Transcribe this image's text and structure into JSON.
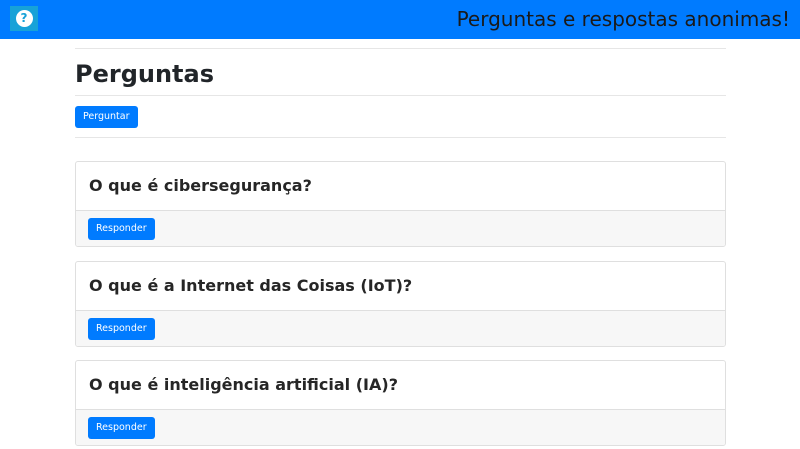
{
  "navbar": {
    "logo_icon": "question-circle-icon",
    "logo_glyph": "?",
    "title": "Perguntas e respostas anonimas!",
    "bg_color": "#007bff"
  },
  "main": {
    "heading": "Perguntas",
    "ask_button": "Perguntar",
    "questions": [
      {
        "title": "O que é cibersegurança?",
        "answer_button": "Responder"
      },
      {
        "title": "O que é a Internet das Coisas (IoT)?",
        "answer_button": "Responder"
      },
      {
        "title": "O que é inteligência artificial (IA)?",
        "answer_button": "Responder"
      }
    ]
  }
}
